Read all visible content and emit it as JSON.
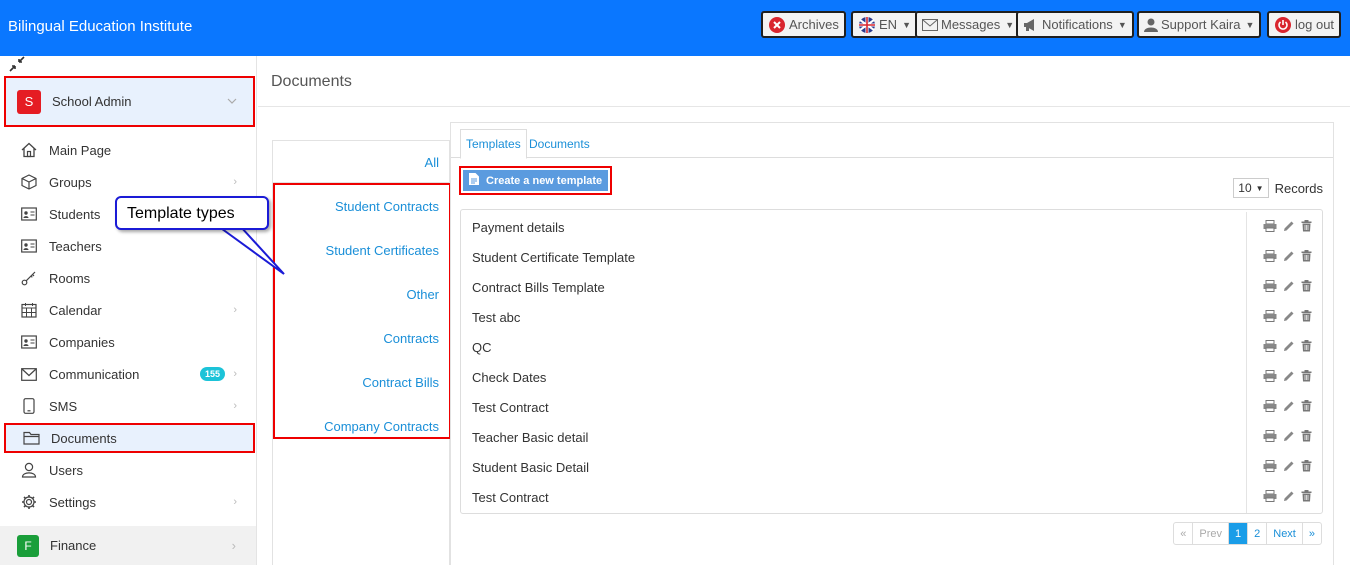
{
  "header": {
    "brand": "Bilingual Education Institute",
    "buttons": {
      "archives": "Archives",
      "language": "EN",
      "messages": "Messages",
      "notifications": "Notifications",
      "user": "Support Kaira",
      "logout": "log out"
    }
  },
  "sidebar": {
    "org": {
      "initial": "S",
      "label": "School Admin"
    },
    "items": [
      {
        "label": "Main Page"
      },
      {
        "label": "Groups"
      },
      {
        "label": "Students"
      },
      {
        "label": "Teachers"
      },
      {
        "label": "Rooms"
      },
      {
        "label": "Calendar"
      },
      {
        "label": "Companies"
      },
      {
        "label": "Communication",
        "badge": "155"
      },
      {
        "label": "SMS"
      },
      {
        "label": "Documents"
      },
      {
        "label": "Users"
      },
      {
        "label": "Settings"
      }
    ],
    "finance": {
      "initial": "F",
      "label": "Finance"
    }
  },
  "page": {
    "title": "Documents"
  },
  "types": {
    "all": "All",
    "items": [
      "Student Contracts",
      "Student Certificates",
      "Other",
      "Contracts",
      "Contract Bills",
      "Company Contracts"
    ]
  },
  "tabs": {
    "templates": "Templates",
    "documents": "Documents"
  },
  "toolbar": {
    "create_label": "Create a new template",
    "records_value": "10",
    "records_label": "Records"
  },
  "templates": [
    "Payment details",
    "Student Certificate Template",
    "Contract Bills Template",
    "Test abc",
    "QC",
    "Check Dates",
    "Test Contract",
    "Teacher Basic detail",
    "Student Basic Detail",
    "Test Contract"
  ],
  "pagination": {
    "first": "«",
    "prev": "Prev",
    "page1": "1",
    "page2": "2",
    "next": "Next",
    "last": "»"
  },
  "callout": {
    "text": "Template types"
  },
  "colors": {
    "accent": "#0a77ff",
    "highlight": "#e00000",
    "link": "#1a8fd8"
  }
}
